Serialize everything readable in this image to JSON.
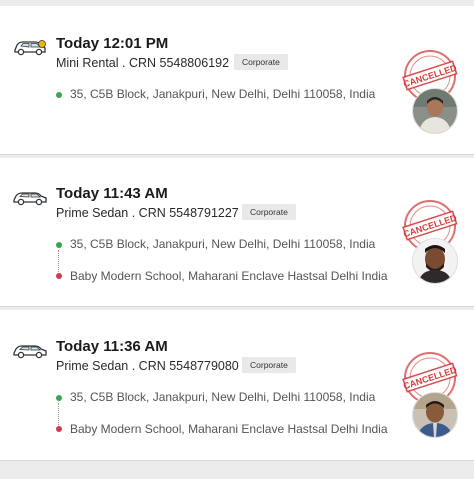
{
  "rides": [
    {
      "time": "Today 12:01 PM",
      "ride": "Mini Rental . CRN 5548806192",
      "badge": "Corporate",
      "stamp": "CANCELLED",
      "pickup": "35, C5B Block, Janakpuri, New Delhi, Delhi 110058, India",
      "drop": "",
      "car_icon": "car-icon",
      "accent": "#d43d3d"
    },
    {
      "time": "Today 11:43 AM",
      "ride": "Prime Sedan . CRN 5548791227",
      "badge": "Corporate",
      "stamp": "CANCELLED",
      "pickup": "35, C5B Block, Janakpuri, New Delhi, Delhi 110058, India",
      "drop": "Baby Modern School, Maharani Enclave Hastsal Delhi India",
      "car_icon": "car-icon",
      "accent": "#d43d3d"
    },
    {
      "time": "Today 11:36 AM",
      "ride": "Prime Sedan . CRN 5548779080",
      "badge": "Corporate",
      "stamp": "CANCELLED",
      "pickup": "35, C5B Block, Janakpuri, New Delhi, Delhi 110058, India",
      "drop": "Baby Modern School, Maharani Enclave Hastsal Delhi India",
      "car_icon": "car-icon",
      "accent": "#d43d3d"
    }
  ]
}
